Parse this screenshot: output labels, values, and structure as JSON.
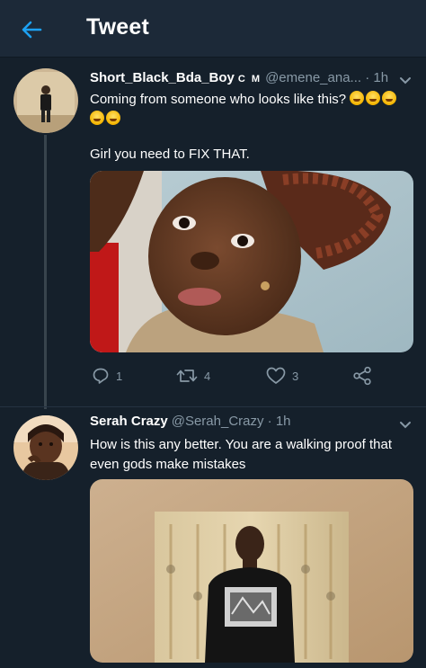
{
  "header": {
    "title": "Tweet",
    "back_icon": "arrow-left-icon",
    "accent": "#1da1f2"
  },
  "tweets": [
    {
      "display_name": "Short_Black_Bda_Boy",
      "badge": "C M",
      "handle": "@emene_ana...",
      "separator": "·",
      "time": "1h",
      "text_line1": "Coming from someone who looks like this?",
      "text_line2": "Girl you need to FIX THAT.",
      "emoji": "grinning-squinting-face",
      "reply_count": "1",
      "retweet_count": "4",
      "like_count": "3"
    },
    {
      "display_name": "Serah Crazy",
      "handle": "@Serah_Crazy",
      "separator": "·",
      "time": "1h",
      "text": "How is this any better. You are a walking proof that even gods make mistakes"
    }
  ],
  "colors": {
    "background": "#15202b",
    "header": "#1c2938",
    "secondary_text": "#8899a6",
    "divider": "#38444d"
  }
}
